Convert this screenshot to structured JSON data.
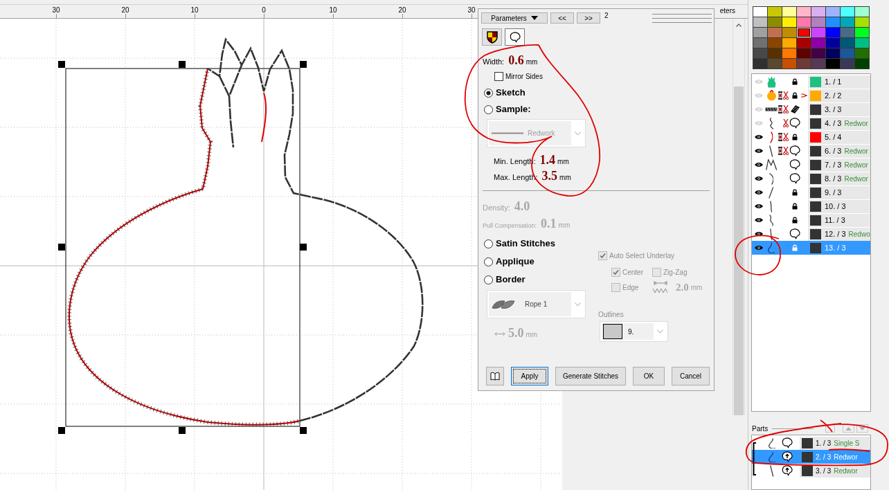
{
  "ruler": {
    "labels": [
      "30",
      "20",
      "10",
      "0",
      "10",
      "20",
      "30"
    ]
  },
  "side_panel": {
    "title": "eters"
  },
  "dialog": {
    "toolbar": {
      "menu": "Parameters",
      "previous": "<<",
      "next": ">>",
      "page": "2"
    },
    "mode_tabs": [
      {
        "kind": "fill",
        "selected": false
      },
      {
        "kind": "outline",
        "selected": true
      }
    ],
    "width": {
      "label": "Width:",
      "value": "0.6",
      "unit": "mm"
    },
    "mirror_sides": {
      "label": "Mirror Sides",
      "checked": false
    },
    "sketch_modes": [
      {
        "label": "Sketch",
        "selected": true
      },
      {
        "label": "Sample:",
        "selected": false
      }
    ],
    "sample": {
      "value": "Redwork",
      "disabled": true
    },
    "min_length": {
      "label": "Min. Length:",
      "value": "1.4",
      "unit": "mm"
    },
    "max_length": {
      "label": "Max. Length:",
      "value": "3.5",
      "unit": "mm"
    },
    "density": {
      "label": "Density:",
      "value": "4.0",
      "disabled": true
    },
    "pull_compensation": {
      "label": "Pull Compensation:",
      "value": "0.1",
      "unit": "mm",
      "disabled": true
    },
    "stitch_types": [
      {
        "label": "Satin Stitches",
        "selected": false
      },
      {
        "label": "Applique",
        "selected": false
      },
      {
        "label": "Border",
        "selected": false
      }
    ],
    "border_pattern": {
      "value": "Rope 1"
    },
    "border_width": {
      "value": "5.0",
      "unit": "mm",
      "disabled": true
    },
    "underlay": {
      "disabled": true,
      "auto": {
        "label": "Auto Select Underlay",
        "checked": true
      },
      "options": [
        {
          "label": "Center",
          "checked": true
        },
        {
          "label": "Zig-Zag",
          "checked": false
        },
        {
          "label": "Edge",
          "checked": false
        }
      ],
      "spacing": {
        "value": "2.0",
        "unit": "mm"
      }
    },
    "outlines": {
      "label": "Outlines",
      "value": "9."
    },
    "buttons": [
      {
        "kind": "book"
      },
      {
        "kind": "text",
        "label": "Apply",
        "focused": true
      },
      {
        "kind": "text",
        "label": "Generate Stitches",
        "focused": false
      },
      {
        "kind": "text",
        "label": "OK",
        "focused": false
      },
      {
        "kind": "text",
        "label": "Cancel",
        "focused": false
      }
    ]
  },
  "palette": [
    {
      "color": "#ffffff",
      "selected": false
    },
    {
      "color": "#c8c800",
      "selected": false
    },
    {
      "color": "#ffff99",
      "selected": false
    },
    {
      "color": "#ffb6c8",
      "selected": false
    },
    {
      "color": "#d8b0f0",
      "selected": false
    },
    {
      "color": "#9cb4ff",
      "selected": false
    },
    {
      "color": "#50ffff",
      "selected": false
    },
    {
      "color": "#a0ffd0",
      "selected": false
    },
    {
      "color": "#c0c0c0",
      "selected": false
    },
    {
      "color": "#8c8c00",
      "selected": false
    },
    {
      "color": "#ffee00",
      "selected": false
    },
    {
      "color": "#ff78a8",
      "selected": false
    },
    {
      "color": "#b080c0",
      "selected": false
    },
    {
      "color": "#2090ff",
      "selected": false
    },
    {
      "color": "#00a8b8",
      "selected": false
    },
    {
      "color": "#a8e000",
      "selected": false
    },
    {
      "color": "#a0a0a0",
      "selected": false
    },
    {
      "color": "#c07050",
      "selected": false
    },
    {
      "color": "#c08c00",
      "selected": false
    },
    {
      "color": "#ff0000",
      "selected": true
    },
    {
      "color": "#cc44ff",
      "selected": false
    },
    {
      "color": "#0000ff",
      "selected": false
    },
    {
      "color": "#4a6a88",
      "selected": false
    },
    {
      "color": "#00ff20",
      "selected": false
    },
    {
      "color": "#707070",
      "selected": false
    },
    {
      "color": "#8b4500",
      "selected": false
    },
    {
      "color": "#ffaa00",
      "selected": false
    },
    {
      "color": "#a80000",
      "selected": false
    },
    {
      "color": "#8c00a8",
      "selected": false
    },
    {
      "color": "#0000a0",
      "selected": false
    },
    {
      "color": "#005878",
      "selected": false
    },
    {
      "color": "#00c080",
      "selected": false
    },
    {
      "color": "#484848",
      "selected": false
    },
    {
      "color": "#5a3000",
      "selected": false
    },
    {
      "color": "#ff7800",
      "selected": false
    },
    {
      "color": "#600000",
      "selected": false
    },
    {
      "color": "#440044",
      "selected": false
    },
    {
      "color": "#000060",
      "selected": false
    },
    {
      "color": "#1a5898",
      "selected": false
    },
    {
      "color": "#207000",
      "selected": false
    },
    {
      "color": "#303030",
      "selected": false
    },
    {
      "color": "#584830",
      "selected": false
    },
    {
      "color": "#c85000",
      "selected": false
    },
    {
      "color": "#703838",
      "selected": false
    },
    {
      "color": "#583858",
      "selected": false
    },
    {
      "color": "#000000",
      "selected": false
    },
    {
      "color": "#383858",
      "selected": false
    },
    {
      "color": "#004000",
      "selected": false
    }
  ],
  "layers": [
    {
      "label": "1. / 1",
      "visible": false,
      "stop": false,
      "trim": false,
      "kind": "lock",
      "tie": false,
      "color": "#1ec080",
      "selected": false
    },
    {
      "label": "2. / 2",
      "visible": false,
      "stop": true,
      "trim": true,
      "kind": "lock",
      "tie": true,
      "color": "#ffaa00",
      "selected": false
    },
    {
      "label": "3. / 3",
      "visible": false,
      "stop": true,
      "trim": true,
      "kind": "pattern",
      "tie": false,
      "color": "#333333",
      "selected": false
    },
    {
      "label": "4. / 3",
      "note": "Redwor",
      "visible": false,
      "stop": false,
      "trim": true,
      "kind": "outline",
      "tie": false,
      "color": "#333333",
      "selected": false
    },
    {
      "label": "5. / 4",
      "visible": true,
      "stop": true,
      "trim": true,
      "kind": "lock",
      "tie": false,
      "color": "#ff0000",
      "selected": false
    },
    {
      "label": "6. / 3",
      "note": "Redwor",
      "visible": true,
      "stop": true,
      "trim": true,
      "kind": "outline",
      "tie": false,
      "color": "#333333",
      "selected": false
    },
    {
      "label": "7. / 3",
      "note": "Redwor",
      "visible": true,
      "stop": false,
      "trim": false,
      "kind": "outline",
      "tie": false,
      "color": "#333333",
      "selected": false
    },
    {
      "label": "8. / 3",
      "note": "Redwor",
      "visible": true,
      "stop": false,
      "trim": false,
      "kind": "outline",
      "tie": false,
      "color": "#333333",
      "selected": false
    },
    {
      "label": "9. / 3",
      "visible": true,
      "stop": false,
      "trim": false,
      "kind": "lock",
      "tie": false,
      "color": "#333333",
      "selected": false
    },
    {
      "label": "10. / 3",
      "visible": true,
      "stop": false,
      "trim": false,
      "kind": "lock",
      "tie": false,
      "color": "#333333",
      "selected": false
    },
    {
      "label": "11. / 3",
      "visible": true,
      "stop": false,
      "trim": false,
      "kind": "lock",
      "tie": false,
      "color": "#333333",
      "selected": false
    },
    {
      "label": "12. / 3",
      "note": "Redwo",
      "visible": true,
      "stop": false,
      "trim": false,
      "kind": "outline",
      "tie": false,
      "color": "#333333",
      "selected": false
    },
    {
      "label": "13. / 3",
      "visible": true,
      "stop": false,
      "trim": false,
      "kind": "lock",
      "tie": false,
      "color": "#333333",
      "selected": true
    }
  ],
  "parts": {
    "title": "Parts",
    "buttons": [
      {
        "kind": "blank"
      },
      {
        "kind": "up"
      },
      {
        "kind": "down"
      }
    ],
    "items": [
      {
        "label": "1. / 3",
        "note": "Single S",
        "kind": "outline",
        "color": "#333333",
        "selected": false
      },
      {
        "label": "2. / 3",
        "note": "Redwor",
        "kind": "outline-start",
        "color": "#333333",
        "selected": true
      },
      {
        "label": "3. / 3",
        "note": "Redwor",
        "kind": "outline-start",
        "color": "#333333",
        "selected": false
      }
    ]
  }
}
